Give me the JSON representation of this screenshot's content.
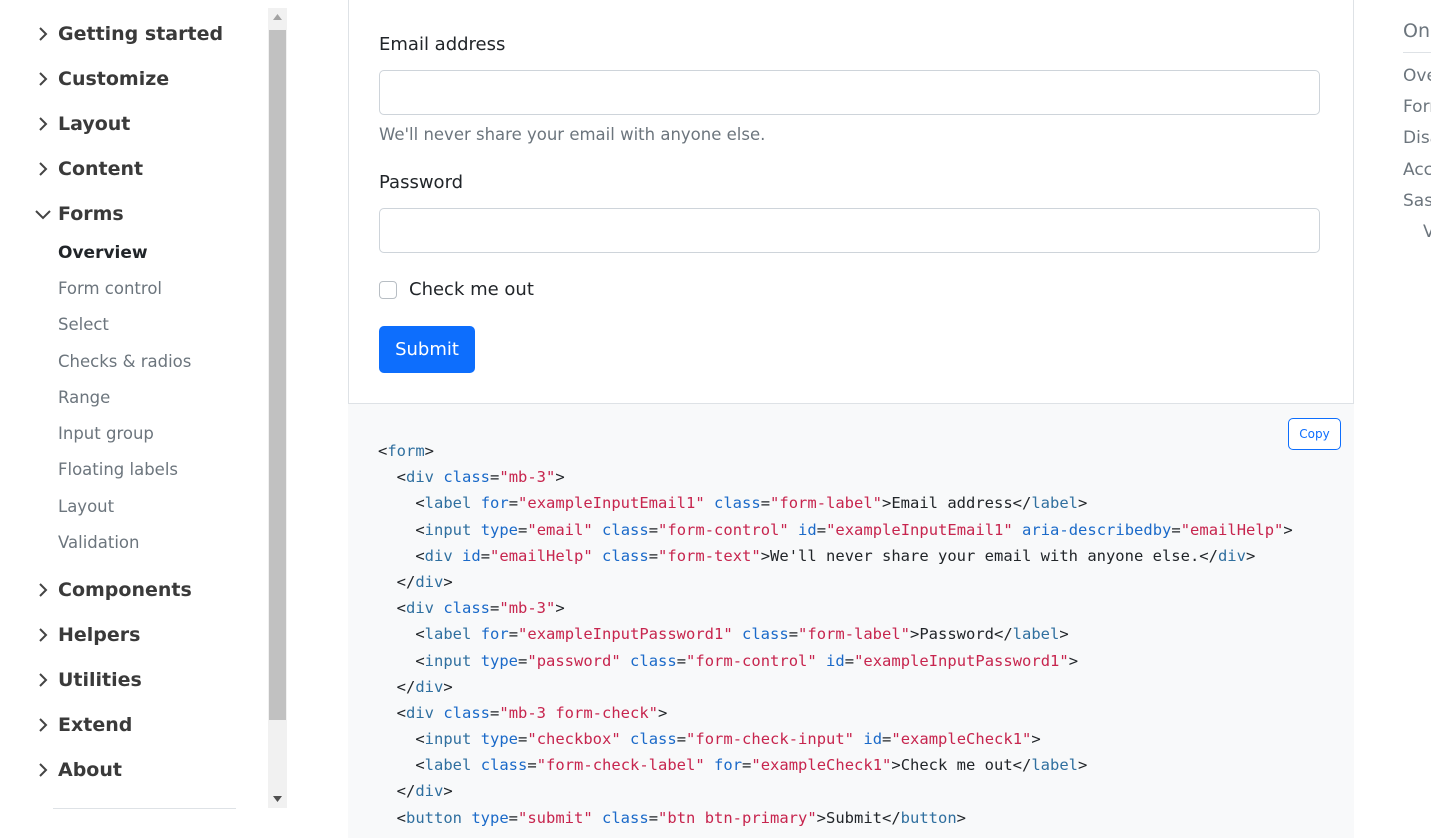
{
  "sidebar": {
    "groups": [
      {
        "label": "Getting started",
        "expanded": false
      },
      {
        "label": "Customize",
        "expanded": false
      },
      {
        "label": "Layout",
        "expanded": false
      },
      {
        "label": "Content",
        "expanded": false
      },
      {
        "label": "Forms",
        "expanded": true
      },
      {
        "label": "Components",
        "expanded": false
      },
      {
        "label": "Helpers",
        "expanded": false
      },
      {
        "label": "Utilities",
        "expanded": false
      },
      {
        "label": "Extend",
        "expanded": false
      },
      {
        "label": "About",
        "expanded": false
      }
    ],
    "forms_items": [
      {
        "label": "Overview",
        "active": true
      },
      {
        "label": "Form control",
        "active": false
      },
      {
        "label": "Select",
        "active": false
      },
      {
        "label": "Checks & radios",
        "active": false
      },
      {
        "label": "Range",
        "active": false
      },
      {
        "label": "Input group",
        "active": false
      },
      {
        "label": "Floating labels",
        "active": false
      },
      {
        "label": "Layout",
        "active": false
      },
      {
        "label": "Validation",
        "active": false
      }
    ]
  },
  "example": {
    "email_label": "Email address",
    "email_value": "",
    "email_help": "We'll never share your email with anyone else.",
    "password_label": "Password",
    "password_value": "",
    "check_label": "Check me out",
    "checked": false,
    "submit_label": "Submit"
  },
  "code": {
    "copy_label": "Copy",
    "lines": [
      [
        [
          "<",
          "punct"
        ],
        [
          "form",
          "tag"
        ],
        [
          ">",
          "punct"
        ]
      ],
      [
        [
          "  <",
          "punct"
        ],
        [
          "div",
          "tag"
        ],
        [
          " ",
          "text"
        ],
        [
          "class",
          "attr"
        ],
        [
          "=",
          "punct"
        ],
        [
          "\"mb-3\"",
          "val"
        ],
        [
          ">",
          "punct"
        ]
      ],
      [
        [
          "    <",
          "punct"
        ],
        [
          "label",
          "tag"
        ],
        [
          " ",
          "text"
        ],
        [
          "for",
          "attr"
        ],
        [
          "=",
          "punct"
        ],
        [
          "\"exampleInputEmail1\"",
          "val"
        ],
        [
          " ",
          "text"
        ],
        [
          "class",
          "attr"
        ],
        [
          "=",
          "punct"
        ],
        [
          "\"form-label\"",
          "val"
        ],
        [
          ">Email address</",
          "punct"
        ],
        [
          "label",
          "tag"
        ],
        [
          ">",
          "punct"
        ]
      ],
      [
        [
          "    <",
          "punct"
        ],
        [
          "input",
          "tag"
        ],
        [
          " ",
          "text"
        ],
        [
          "type",
          "attr"
        ],
        [
          "=",
          "punct"
        ],
        [
          "\"email\"",
          "val"
        ],
        [
          " ",
          "text"
        ],
        [
          "class",
          "attr"
        ],
        [
          "=",
          "punct"
        ],
        [
          "\"form-control\"",
          "val"
        ],
        [
          " ",
          "text"
        ],
        [
          "id",
          "attr"
        ],
        [
          "=",
          "punct"
        ],
        [
          "\"exampleInputEmail1\"",
          "val"
        ],
        [
          " ",
          "text"
        ],
        [
          "aria-describedby",
          "attr"
        ],
        [
          "=",
          "punct"
        ],
        [
          "\"emailHelp\"",
          "val"
        ],
        [
          ">",
          "punct"
        ]
      ],
      [
        [
          "    <",
          "punct"
        ],
        [
          "div",
          "tag"
        ],
        [
          " ",
          "text"
        ],
        [
          "id",
          "attr"
        ],
        [
          "=",
          "punct"
        ],
        [
          "\"emailHelp\"",
          "val"
        ],
        [
          " ",
          "text"
        ],
        [
          "class",
          "attr"
        ],
        [
          "=",
          "punct"
        ],
        [
          "\"form-text\"",
          "val"
        ],
        [
          ">We'll never share your email with anyone else.</",
          "punct"
        ],
        [
          "div",
          "tag"
        ],
        [
          ">",
          "punct"
        ]
      ],
      [
        [
          "  </",
          "punct"
        ],
        [
          "div",
          "tag"
        ],
        [
          ">",
          "punct"
        ]
      ],
      [
        [
          "  <",
          "punct"
        ],
        [
          "div",
          "tag"
        ],
        [
          " ",
          "text"
        ],
        [
          "class",
          "attr"
        ],
        [
          "=",
          "punct"
        ],
        [
          "\"mb-3\"",
          "val"
        ],
        [
          ">",
          "punct"
        ]
      ],
      [
        [
          "    <",
          "punct"
        ],
        [
          "label",
          "tag"
        ],
        [
          " ",
          "text"
        ],
        [
          "for",
          "attr"
        ],
        [
          "=",
          "punct"
        ],
        [
          "\"exampleInputPassword1\"",
          "val"
        ],
        [
          " ",
          "text"
        ],
        [
          "class",
          "attr"
        ],
        [
          "=",
          "punct"
        ],
        [
          "\"form-label\"",
          "val"
        ],
        [
          ">Password</",
          "punct"
        ],
        [
          "label",
          "tag"
        ],
        [
          ">",
          "punct"
        ]
      ],
      [
        [
          "    <",
          "punct"
        ],
        [
          "input",
          "tag"
        ],
        [
          " ",
          "text"
        ],
        [
          "type",
          "attr"
        ],
        [
          "=",
          "punct"
        ],
        [
          "\"password\"",
          "val"
        ],
        [
          " ",
          "text"
        ],
        [
          "class",
          "attr"
        ],
        [
          "=",
          "punct"
        ],
        [
          "\"form-control\"",
          "val"
        ],
        [
          " ",
          "text"
        ],
        [
          "id",
          "attr"
        ],
        [
          "=",
          "punct"
        ],
        [
          "\"exampleInputPassword1\"",
          "val"
        ],
        [
          ">",
          "punct"
        ]
      ],
      [
        [
          "  </",
          "punct"
        ],
        [
          "div",
          "tag"
        ],
        [
          ">",
          "punct"
        ]
      ],
      [
        [
          "  <",
          "punct"
        ],
        [
          "div",
          "tag"
        ],
        [
          " ",
          "text"
        ],
        [
          "class",
          "attr"
        ],
        [
          "=",
          "punct"
        ],
        [
          "\"mb-3 form-check\"",
          "val"
        ],
        [
          ">",
          "punct"
        ]
      ],
      [
        [
          "    <",
          "punct"
        ],
        [
          "input",
          "tag"
        ],
        [
          " ",
          "text"
        ],
        [
          "type",
          "attr"
        ],
        [
          "=",
          "punct"
        ],
        [
          "\"checkbox\"",
          "val"
        ],
        [
          " ",
          "text"
        ],
        [
          "class",
          "attr"
        ],
        [
          "=",
          "punct"
        ],
        [
          "\"form-check-input\"",
          "val"
        ],
        [
          " ",
          "text"
        ],
        [
          "id",
          "attr"
        ],
        [
          "=",
          "punct"
        ],
        [
          "\"exampleCheck1\"",
          "val"
        ],
        [
          ">",
          "punct"
        ]
      ],
      [
        [
          "    <",
          "punct"
        ],
        [
          "label",
          "tag"
        ],
        [
          " ",
          "text"
        ],
        [
          "class",
          "attr"
        ],
        [
          "=",
          "punct"
        ],
        [
          "\"form-check-label\"",
          "val"
        ],
        [
          " ",
          "text"
        ],
        [
          "for",
          "attr"
        ],
        [
          "=",
          "punct"
        ],
        [
          "\"exampleCheck1\"",
          "val"
        ],
        [
          ">Check me out</",
          "punct"
        ],
        [
          "label",
          "tag"
        ],
        [
          ">",
          "punct"
        ]
      ],
      [
        [
          "  </",
          "punct"
        ],
        [
          "div",
          "tag"
        ],
        [
          ">",
          "punct"
        ]
      ],
      [
        [
          "  <",
          "punct"
        ],
        [
          "button",
          "tag"
        ],
        [
          " ",
          "text"
        ],
        [
          "type",
          "attr"
        ],
        [
          "=",
          "punct"
        ],
        [
          "\"submit\"",
          "val"
        ],
        [
          " ",
          "text"
        ],
        [
          "class",
          "attr"
        ],
        [
          "=",
          "punct"
        ],
        [
          "\"btn btn-primary\"",
          "val"
        ],
        [
          ">Submit</",
          "punct"
        ],
        [
          "button",
          "tag"
        ],
        [
          ">",
          "punct"
        ]
      ]
    ]
  },
  "toc": {
    "title": "On",
    "items": [
      "Ove",
      "Forr",
      "Disa",
      "Acc",
      "Sas",
      "V"
    ]
  },
  "colors": {
    "primary": "#0d6efd",
    "muted": "#6c757d",
    "code_bg": "#f8f9fa",
    "code_tag": "#2f6f9f",
    "code_attr": "#1b6ac9",
    "code_value": "#c7254e"
  }
}
